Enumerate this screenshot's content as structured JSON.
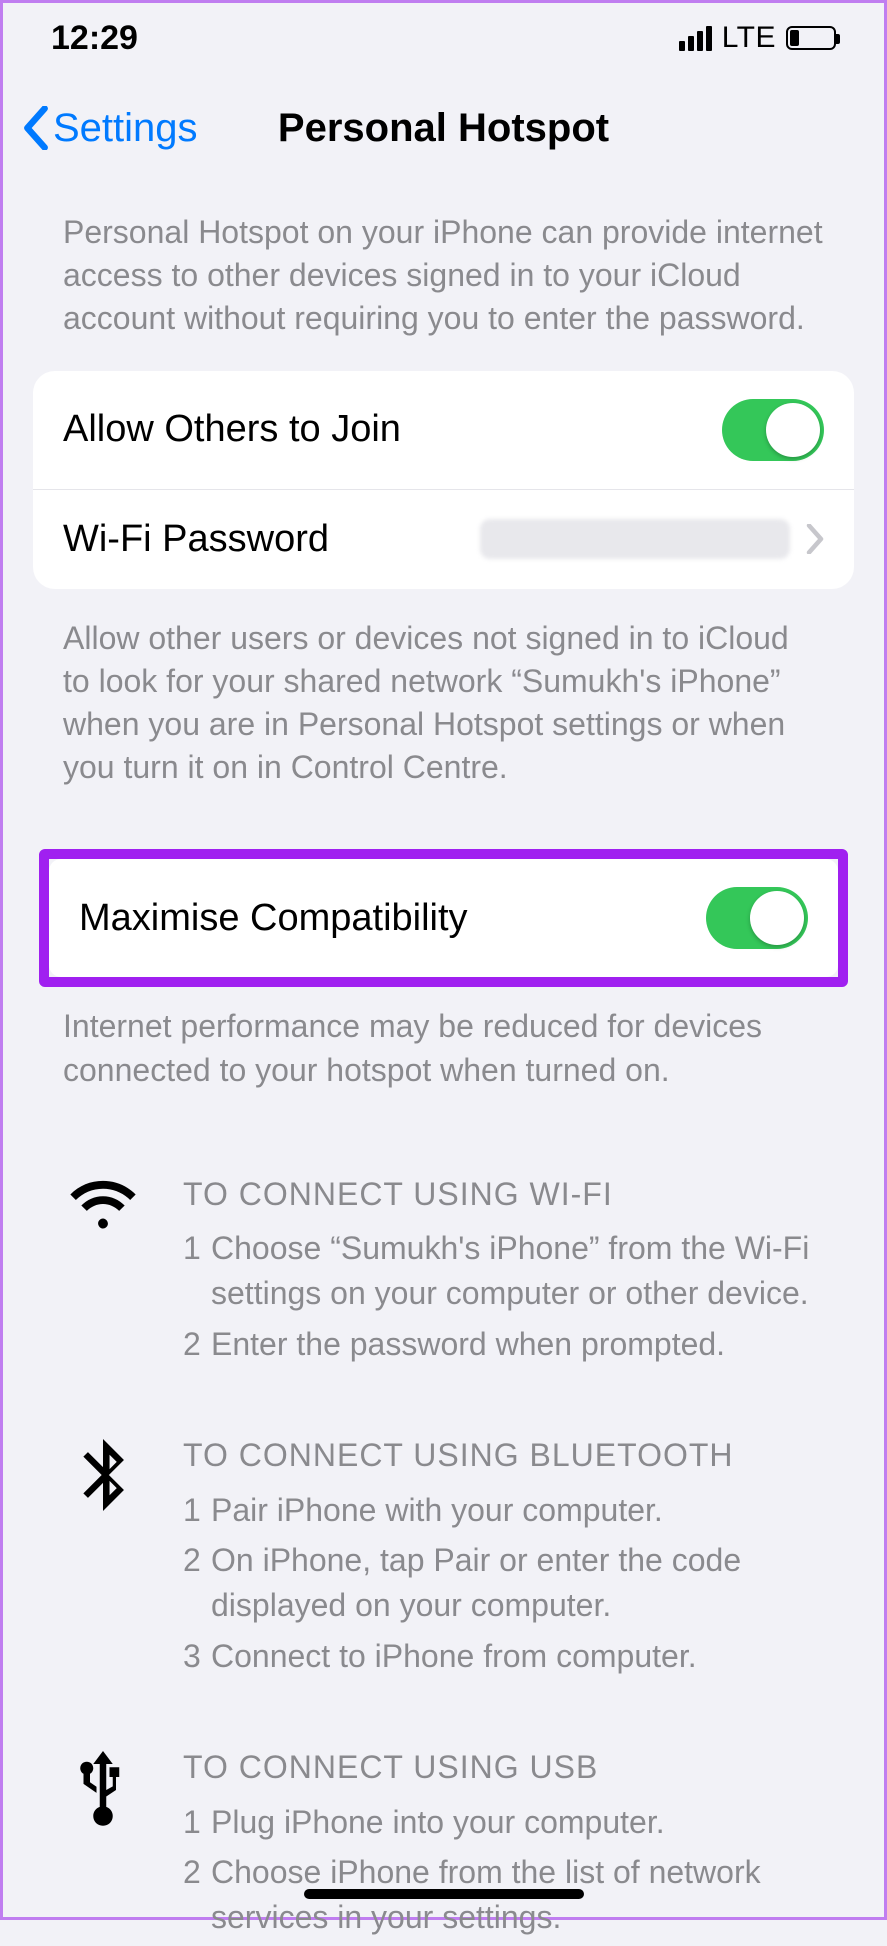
{
  "status": {
    "time": "12:29",
    "network_label": "LTE"
  },
  "nav": {
    "back_label": "Settings",
    "title": "Personal Hotspot"
  },
  "intro_text": "Personal Hotspot on your iPhone can provide internet access to other devices signed in to your iCloud account without requiring you to enter the password.",
  "group1": {
    "allow_others_label": "Allow Others to Join",
    "wifi_password_label": "Wi-Fi Password"
  },
  "group1_footer": "Allow other users or devices not signed in to iCloud to look for your shared network “Sumukh's iPhone” when you are in Personal Hotspot settings or when you turn it on in Control Centre.",
  "group2": {
    "maximise_label": "Maximise Compatibility"
  },
  "group2_footer": "Internet performance may be reduced for devices connected to your hotspot when turned on.",
  "instructions": {
    "wifi": {
      "title": "TO CONNECT USING WI-FI",
      "step1": "Choose “Sumukh's iPhone” from the Wi-Fi settings on your computer or other device.",
      "step2": "Enter the password when prompted."
    },
    "bluetooth": {
      "title": "TO CONNECT USING BLUETOOTH",
      "step1": "Pair iPhone with your computer.",
      "step2": "On iPhone, tap Pair or enter the code displayed on your computer.",
      "step3": "Connect to iPhone from computer."
    },
    "usb": {
      "title": "TO CONNECT USING USB",
      "step1": "Plug iPhone into your computer.",
      "step2": "Choose iPhone from the list of network services in your settings."
    }
  }
}
